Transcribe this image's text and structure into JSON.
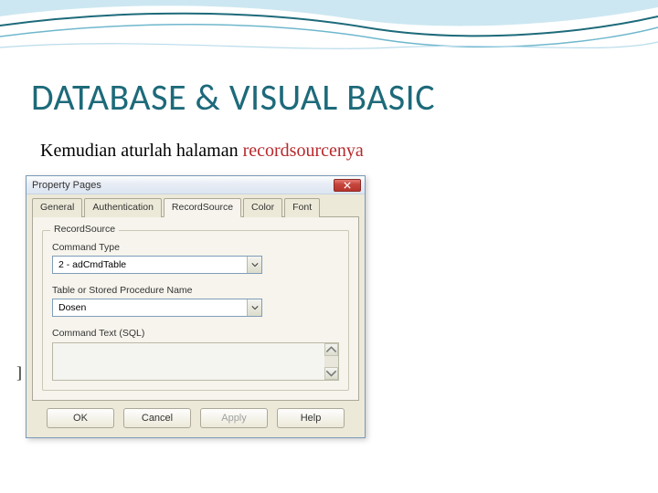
{
  "slide": {
    "title": "DATABASE & VISUAL BASIC",
    "subtitle_plain": "Kemudian aturlah halaman ",
    "subtitle_accent": "recordsourcenya"
  },
  "dialog": {
    "title": "Property Pages",
    "tabs": [
      "General",
      "Authentication",
      "RecordSource",
      "Color",
      "Font"
    ],
    "active_tab_index": 2,
    "group_legend": "RecordSource",
    "command_type_label": "Command Type",
    "command_type_value": "2 - adCmdTable",
    "table_label": "Table or Stored Procedure Name",
    "table_value": "Dosen",
    "command_text_label": "Command Text (SQL)",
    "buttons": {
      "ok": "OK",
      "cancel": "Cancel",
      "apply": "Apply",
      "help": "Help"
    }
  },
  "stray": {
    "bracket": "]"
  }
}
